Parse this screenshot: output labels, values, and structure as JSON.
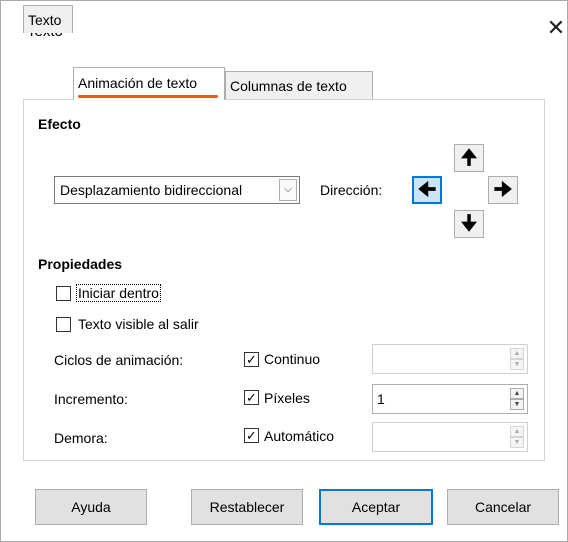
{
  "window": {
    "title": "Texto"
  },
  "tabs": [
    {
      "label": "Texto"
    },
    {
      "label": "Animación de texto"
    },
    {
      "label": "Columnas de texto"
    }
  ],
  "effect": {
    "heading": "Efecto",
    "selected": "Desplazamiento bidireccional",
    "direction_label": "Dirección:",
    "active_direction": "left"
  },
  "properties": {
    "heading": "Propiedades",
    "start_inside": {
      "label": "Iniciar dentro",
      "checked": false
    },
    "visible_on_exit": {
      "label": "Texto visible al salir",
      "checked": false
    },
    "animation_cycles": {
      "label": "Ciclos de animación:",
      "check_label": "Continuo",
      "checked": true,
      "value": ""
    },
    "increment": {
      "label": "Incremento:",
      "check_label": "Píxeles",
      "checked": true,
      "value": "1"
    },
    "delay": {
      "label": "Demora:",
      "check_label": "Automático",
      "checked": true,
      "value": ""
    }
  },
  "buttons": {
    "help": "Ayuda",
    "reset": "Restablecer",
    "ok": "Aceptar",
    "cancel": "Cancelar"
  }
}
